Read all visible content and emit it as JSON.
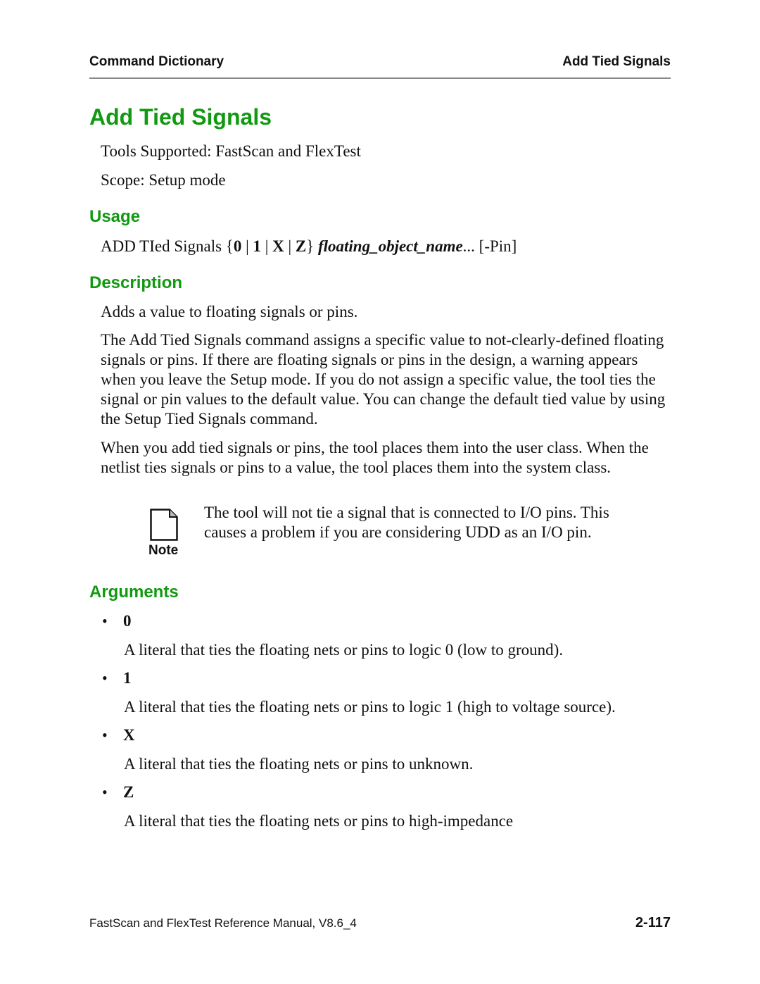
{
  "header": {
    "left": "Command Dictionary",
    "right": "Add Tied Signals"
  },
  "title": "Add Tied Signals",
  "meta": {
    "tools_supported": "Tools Supported: FastScan and FlexTest",
    "scope": "Scope: Setup mode"
  },
  "usage": {
    "heading": "Usage",
    "command_prefix": "ADD TIed Signals {",
    "opt_0": "0",
    "opt_1": "1",
    "opt_x": "X",
    "opt_z": "Z",
    "sep": " | ",
    "close_brace": "} ",
    "object_name": "floating_object_name",
    "ellipsis": "... ",
    "pin_switch": "[-Pin]"
  },
  "description": {
    "heading": "Description",
    "summary": "Adds a value to floating signals or pins.",
    "para1": "The Add Tied Signals command assigns a specific value to not-clearly-defined floating signals or pins. If there are floating signals or pins in the design, a warning appears when you leave the Setup mode. If you do not assign a specific value, the tool ties the signal or pin values to the default value. You can change the default tied value by using the Setup Tied Signals command.",
    "para2": "When you add tied signals or pins, the tool places them into the user class. When the netlist ties signals or pins to a value, the tool places them into the system class."
  },
  "note": {
    "label": "Note",
    "icon": "document-note-icon",
    "text": "The tool will not tie a signal that is connected to I/O pins. This causes a problem if you are considering UDD as an I/O pin."
  },
  "arguments": {
    "heading": "Arguments",
    "bullet_glyph": "•",
    "items": [
      {
        "name": "0",
        "desc": "A literal that ties the floating nets or pins to logic 0 (low to ground)."
      },
      {
        "name": "1",
        "desc": "A literal that ties the floating nets or pins to logic 1 (high to voltage source)."
      },
      {
        "name": "X",
        "desc": "A literal that ties the floating nets or pins to unknown."
      },
      {
        "name": "Z",
        "desc": "A literal that ties the floating nets or pins to high-impedance"
      }
    ]
  },
  "footer": {
    "manual": "FastScan and FlexTest Reference Manual, V8.6_4",
    "page": "2-117"
  }
}
